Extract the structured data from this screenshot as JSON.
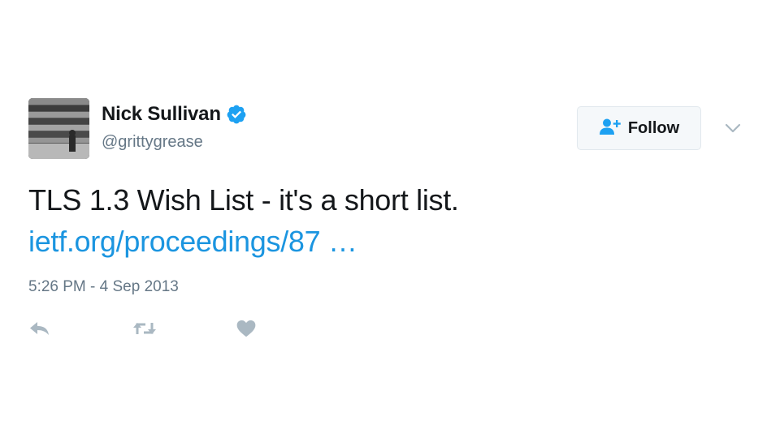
{
  "user": {
    "name": "Nick Sullivan",
    "handle": "@grittygrease",
    "verified": true
  },
  "follow_button": {
    "label": "Follow",
    "icon": "add-user-icon"
  },
  "menu": {
    "icon": "chevron-down-icon"
  },
  "tweet": {
    "text": "TLS 1.3 Wish List - it's a short list.",
    "link_text": "ietf.org/proceedings/87 …",
    "timestamp": "5:26 PM - 4 Sep 2013"
  },
  "actions": [
    {
      "icon": "reply-icon"
    },
    {
      "icon": "retweet-icon"
    },
    {
      "icon": "like-icon"
    }
  ],
  "colors": {
    "link": "#1b95e0",
    "verified": "#1da1f2",
    "secondary_text": "#657786",
    "action_icon": "#aab8c2"
  }
}
